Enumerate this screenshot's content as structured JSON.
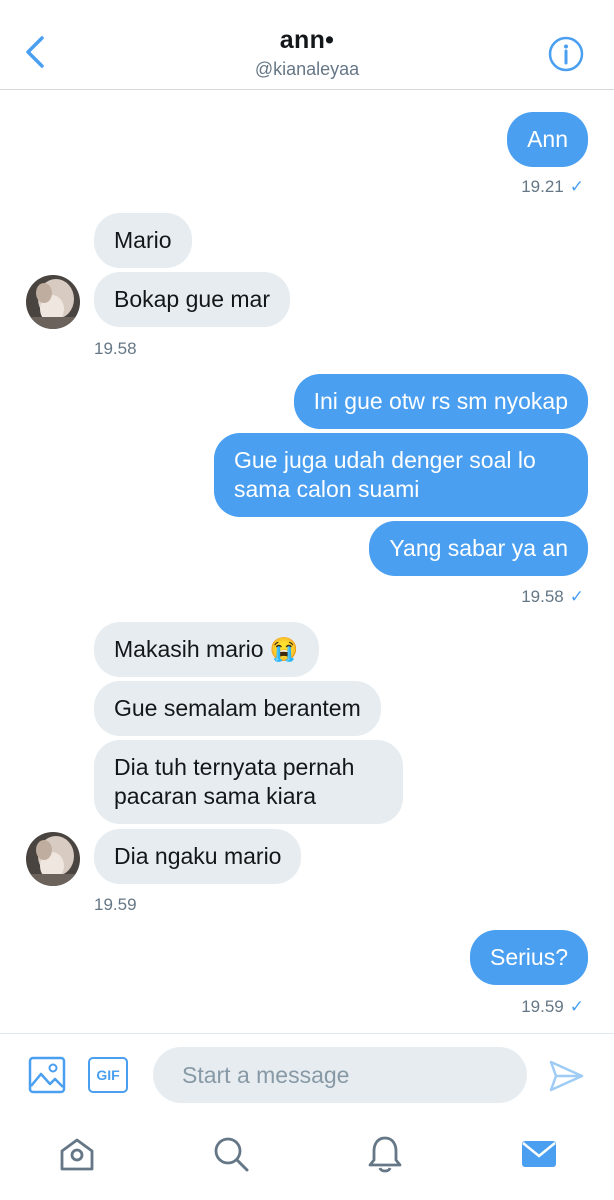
{
  "header": {
    "title": "ann•",
    "handle": "@kianaleyaa",
    "back_icon": "chevron-left-icon",
    "info_icon": "info-icon"
  },
  "colors": {
    "accent": "#4a9ff0",
    "incoming_bubble": "#e6ecf0",
    "muted_text": "#657786"
  },
  "messages": [
    {
      "dir": "out",
      "text": "Ann"
    },
    {
      "dir": "out_time",
      "time": "19.21",
      "check": "✓"
    },
    {
      "dir": "in",
      "text": "Mario"
    },
    {
      "dir": "in",
      "text": "Bokap gue mar"
    },
    {
      "dir": "in_time",
      "time": "19.58"
    },
    {
      "dir": "out",
      "text": "Ini gue otw rs sm nyokap"
    },
    {
      "dir": "out",
      "text": "Gue juga udah denger soal lo sama calon suami"
    },
    {
      "dir": "out",
      "text": "Yang sabar ya an"
    },
    {
      "dir": "out_time",
      "time": "19.58",
      "check": "✓"
    },
    {
      "dir": "in",
      "text": "Makasih mario 😭"
    },
    {
      "dir": "in",
      "text": "Gue semalam berantem"
    },
    {
      "dir": "in",
      "text": "Dia tuh ternyata pernah pacaran sama kiara"
    },
    {
      "dir": "in",
      "text": "Dia ngaku mario"
    },
    {
      "dir": "in_time",
      "time": "19.59"
    },
    {
      "dir": "out",
      "text": "Serius?"
    },
    {
      "dir": "out_time",
      "time": "19.59",
      "check": "✓"
    }
  ],
  "composer": {
    "placeholder": "Start a message",
    "gif_label": "GIF",
    "image_icon": "image-icon",
    "send_icon": "send-icon"
  },
  "tabs": [
    {
      "name": "home-icon",
      "active": false
    },
    {
      "name": "search-icon",
      "active": false
    },
    {
      "name": "notifications-icon",
      "active": false
    },
    {
      "name": "messages-icon",
      "active": true
    }
  ]
}
